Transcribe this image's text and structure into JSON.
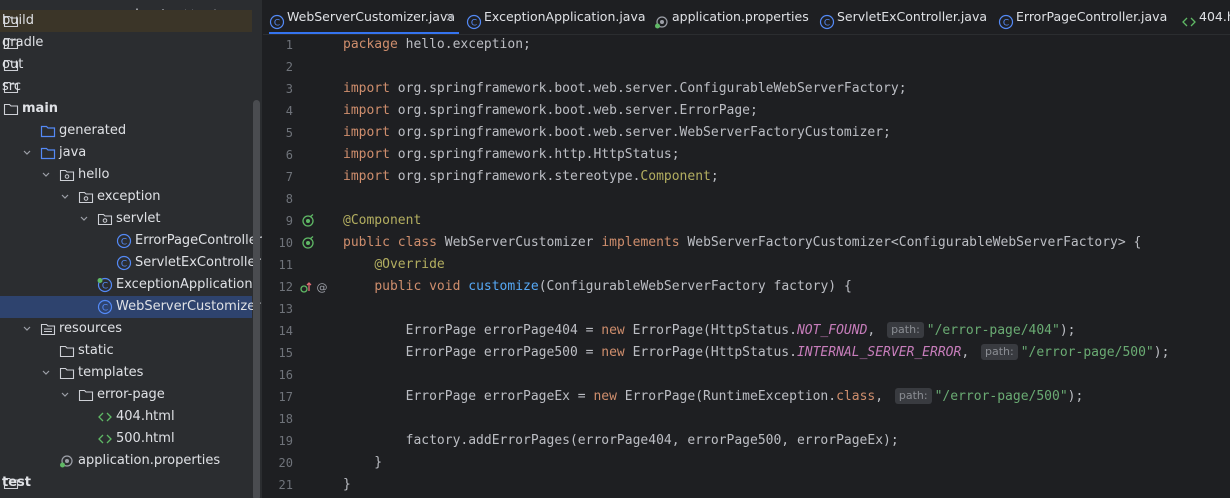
{
  "project_tree": {
    "toolbar_icons": [
      "crosshair-icon",
      "expand-collapse-icon",
      "collapse-all-icon",
      "more-icon",
      "minimize-icon"
    ],
    "items": [
      {
        "label": "build",
        "depth": 0,
        "arrow": "",
        "icon": "folder"
      },
      {
        "label": "gradle",
        "depth": 0,
        "arrow": "",
        "icon": "folder"
      },
      {
        "label": "out",
        "depth": 0,
        "arrow": "",
        "icon": "folder"
      },
      {
        "label": "src",
        "depth": 0,
        "arrow": "",
        "icon": "folder"
      },
      {
        "label": "main",
        "depth": 0,
        "arrow": "",
        "icon": "folder"
      },
      {
        "label": "generated",
        "depth": 1,
        "arrow": "",
        "icon": "source-folder"
      },
      {
        "label": "java",
        "depth": 1,
        "arrow": "down",
        "icon": "source-folder"
      },
      {
        "label": "hello",
        "depth": 2,
        "arrow": "down",
        "icon": "package"
      },
      {
        "label": "exception",
        "depth": 3,
        "arrow": "down",
        "icon": "package"
      },
      {
        "label": "servlet",
        "depth": 4,
        "arrow": "down",
        "icon": "package"
      },
      {
        "label": "ErrorPageController",
        "depth": 5,
        "arrow": "",
        "icon": "class"
      },
      {
        "label": "ServletExController",
        "depth": 5,
        "arrow": "",
        "icon": "class"
      },
      {
        "label": "ExceptionApplication",
        "depth": 4,
        "arrow": "",
        "icon": "spring-class"
      },
      {
        "label": "WebServerCustomizer",
        "depth": 4,
        "arrow": "",
        "icon": "class"
      },
      {
        "label": "resources",
        "depth": 1,
        "arrow": "down",
        "icon": "resource-folder"
      },
      {
        "label": "static",
        "depth": 2,
        "arrow": "",
        "icon": "folder"
      },
      {
        "label": "templates",
        "depth": 2,
        "arrow": "down",
        "icon": "folder"
      },
      {
        "label": "error-page",
        "depth": 3,
        "arrow": "down",
        "icon": "folder"
      },
      {
        "label": "404.html",
        "depth": 4,
        "arrow": "",
        "icon": "html"
      },
      {
        "label": "500.html",
        "depth": 4,
        "arrow": "",
        "icon": "html"
      },
      {
        "label": "application.properties",
        "depth": 2,
        "arrow": "",
        "icon": "properties"
      },
      {
        "label": "test",
        "depth": 0,
        "arrow": "",
        "icon": "folder"
      }
    ],
    "selected_index": 13
  },
  "tabs": [
    {
      "label": "WebServerCustomizer.java",
      "icon": "class",
      "active": true,
      "closable": true
    },
    {
      "label": "ExceptionApplication.java",
      "icon": "class",
      "active": false
    },
    {
      "label": "application.properties",
      "icon": "properties",
      "active": false
    },
    {
      "label": "ServletExController.java",
      "icon": "class",
      "active": false
    },
    {
      "label": "ErrorPageController.java",
      "icon": "class",
      "active": false
    },
    {
      "label": "404.h",
      "icon": "html",
      "active": false
    }
  ],
  "editor": {
    "close_glyph": "×",
    "hint_path": "path:",
    "lines": [
      {
        "n": "1",
        "text": "package hello.exception;"
      },
      {
        "n": "2",
        "text": ""
      },
      {
        "n": "3",
        "text": "import org.springframework.boot.web.server.ConfigurableWebServerFactory;"
      },
      {
        "n": "4",
        "text": "import org.springframework.boot.web.server.ErrorPage;"
      },
      {
        "n": "5",
        "text": "import org.springframework.boot.web.server.WebServerFactoryCustomizer;"
      },
      {
        "n": "6",
        "text": "import org.springframework.http.HttpStatus;"
      },
      {
        "n": "7",
        "text": "import org.springframework.stereotype.Component;"
      },
      {
        "n": "8",
        "text": ""
      },
      {
        "n": "9",
        "text": "@Component"
      },
      {
        "n": "10",
        "text": "public class WebServerCustomizer implements WebServerFactoryCustomizer<ConfigurableWebServerFactory> {"
      },
      {
        "n": "11",
        "text": "    @Override"
      },
      {
        "n": "12",
        "text": "    public void customize(ConfigurableWebServerFactory factory) {"
      },
      {
        "n": "13",
        "text": ""
      },
      {
        "n": "14",
        "text": "        ErrorPage errorPage404 = new ErrorPage(HttpStatus.NOT_FOUND, \"/error-page/404\");"
      },
      {
        "n": "15",
        "text": "        ErrorPage errorPage500 = new ErrorPage(HttpStatus.INTERNAL_SERVER_ERROR, \"/error-page/500\");"
      },
      {
        "n": "16",
        "text": ""
      },
      {
        "n": "17",
        "text": "        ErrorPage errorPageEx = new ErrorPage(RuntimeException.class, \"/error-page/500\");"
      },
      {
        "n": "18",
        "text": ""
      },
      {
        "n": "19",
        "text": "        factory.addErrorPages(errorPage404, errorPage500, errorPageEx);"
      },
      {
        "n": "20",
        "text": "    }"
      },
      {
        "n": "21",
        "text": "}"
      }
    ]
  },
  "colors": {
    "keyword": "#cf8e6d",
    "annotation": "#b3ae60",
    "method": "#56a8f5",
    "string": "#6aab73",
    "constant": "#c77dbb",
    "selection": "#2e436e"
  }
}
